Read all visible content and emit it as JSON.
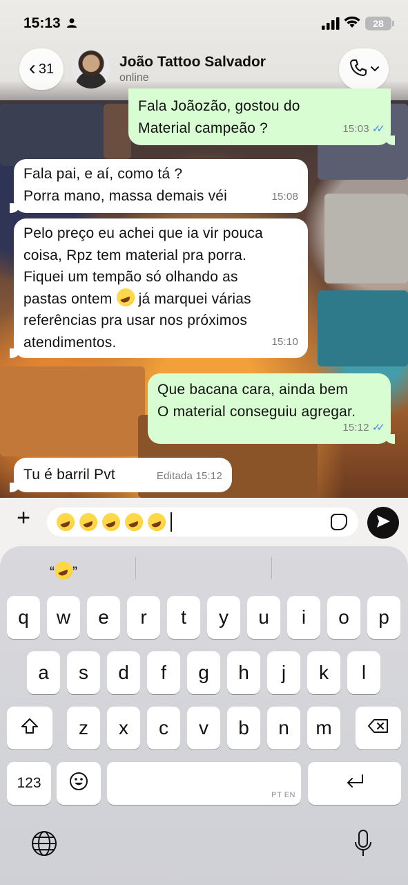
{
  "status_bar": {
    "time": "15:13",
    "battery": "28"
  },
  "header": {
    "back_label": "‹",
    "back_count": "31",
    "contact_name": "João Tattoo Salvador",
    "contact_status": "online"
  },
  "messages": [
    {
      "direction": "out",
      "lines": [
        "Fala Joãozão, gostou do",
        "Material campeão ?"
      ],
      "time": "15:03",
      "read": true
    },
    {
      "direction": "in",
      "lines": [
        "Fala pai, e aí, como tá ?",
        "Porra mano, massa demais véi"
      ],
      "time": "15:08"
    },
    {
      "direction": "in",
      "lines": [
        "Pelo preço eu achei que ia vir pouca",
        "coisa, Rpz tem material pra porra.",
        "Fiquei um tempão só olhando as",
        "pastas ontem",
        "já marquei várias",
        "referências pra usar nos próximos",
        "atendimentos."
      ],
      "time": "15:10"
    },
    {
      "direction": "out",
      "lines": [
        "Que bacana cara, ainda bem",
        "O material conseguiu agregar."
      ],
      "time": "15:12",
      "read": true
    },
    {
      "direction": "in",
      "lines": [
        "Tu é barril Pvt"
      ],
      "time": "Editada 15:12"
    }
  ],
  "composer": {
    "emoji_count": 5
  },
  "keyboard": {
    "suggestion_quote_open": "“",
    "suggestion_quote_close": "”",
    "row1": [
      "q",
      "w",
      "e",
      "r",
      "t",
      "y",
      "u",
      "i",
      "o",
      "p"
    ],
    "row2": [
      "a",
      "s",
      "d",
      "f",
      "g",
      "h",
      "j",
      "k",
      "l"
    ],
    "row3": [
      "z",
      "x",
      "c",
      "v",
      "b",
      "n",
      "m"
    ],
    "numbers_key": "123",
    "space_languages": "PT EN"
  },
  "colors": {
    "outgoing_bubble": "#d9fdd3",
    "incoming_bubble": "#ffffff",
    "read_ticks": "#3b8fe6"
  }
}
